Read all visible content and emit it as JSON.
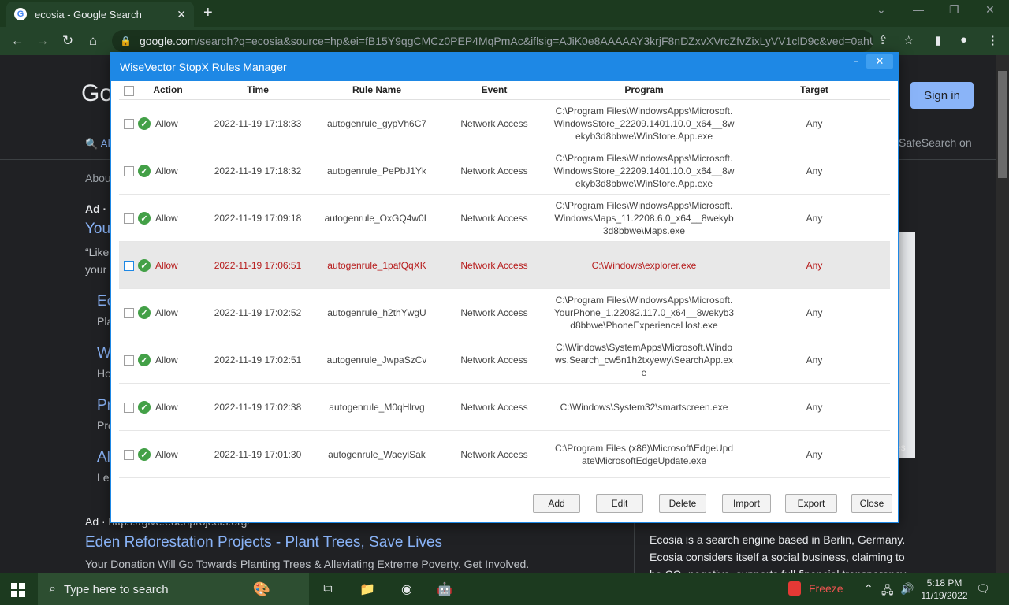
{
  "browser": {
    "tab_title": "ecosia - Google Search",
    "url_host": "google.com",
    "url_rest": "/search?q=ecosia&source=hp&ei=fB15Y9qgCMCz0PEP4MqPmAc&iflsig=AJiK0e8AAAAAY3krjF8nDZxvXVrcZfvZixLyVV1clD9c&ved=0ahU...",
    "icons": [
      "back-icon",
      "forward-icon",
      "reload-icon",
      "home-icon",
      "lock-icon",
      "share-icon",
      "star-icon",
      "sidebar-icon",
      "profile-icon",
      "menu-icon"
    ]
  },
  "page": {
    "logo_partial": "Go",
    "sign_in": "Sign in",
    "safesearch": "SafeSearch on",
    "all_tab_partial": "Al",
    "about_partial": "Abou",
    "ad_label_1": "Ad ·",
    "you_partial": "You",
    "like_partial": "“Like",
    "your_partial": "your s",
    "side_links": [
      "Ec",
      "W",
      "Pr",
      "Al"
    ],
    "side_texts": [
      "Pla",
      "Ho",
      "Pro",
      "Le"
    ],
    "ad_label_2": "Ad · https://give.edenprojects.org/",
    "ad_title": "Eden Reforestation Projects - Plant Trees, Save Lives",
    "ad_desc": "Your Donation Will Go Towards Planting Trees & Alleviating Extreme Poverty. Get Involved.",
    "right_text": "Ecosia is a search engine based in Berlin, Germany. Ecosia considers itself a social business, claiming to be CO- negative, supports full financial transparency",
    "img_caption_partial": "es"
  },
  "dialog": {
    "title": "WiseVector StopX Rules Manager",
    "columns": {
      "action": "Action",
      "time": "Time",
      "rule": "Rule Name",
      "event": "Event",
      "program": "Program",
      "target": "Target"
    },
    "rows": [
      {
        "action": "Allow",
        "time": "2022-11-19 17:18:33",
        "rule": "autogenrule_gypVh6C7",
        "event": "Network Access",
        "program": "C:\\Program Files\\WindowsApps\\Microsoft.WindowsStore_22209.1401.10.0_x64__8wekyb3d8bbwe\\WinStore.App.exe",
        "target": "Any"
      },
      {
        "action": "Allow",
        "time": "2022-11-19 17:18:32",
        "rule": "autogenrule_PePbJ1Yk",
        "event": "Network Access",
        "program": "C:\\Program Files\\WindowsApps\\Microsoft.WindowsStore_22209.1401.10.0_x64__8wekyb3d8bbwe\\WinStore.App.exe",
        "target": "Any"
      },
      {
        "action": "Allow",
        "time": "2022-11-19 17:09:18",
        "rule": "autogenrule_OxGQ4w0L",
        "event": "Network Access",
        "program": "C:\\Program Files\\WindowsApps\\Microsoft.WindowsMaps_11.2208.6.0_x64__8wekyb3d8bbwe\\Maps.exe",
        "target": "Any"
      },
      {
        "action": "Allow",
        "time": "2022-11-19 17:06:51",
        "rule": "autogenrule_1pafQqXK",
        "event": "Network Access",
        "program": "C:\\Windows\\explorer.exe",
        "target": "Any"
      },
      {
        "action": "Allow",
        "time": "2022-11-19 17:02:52",
        "rule": "autogenrule_h2thYwgU",
        "event": "Network Access",
        "program": "C:\\Program Files\\WindowsApps\\Microsoft.YourPhone_1.22082.117.0_x64__8wekyb3d8bbwe\\PhoneExperienceHost.exe",
        "target": "Any"
      },
      {
        "action": "Allow",
        "time": "2022-11-19 17:02:51",
        "rule": "autogenrule_JwpaSzCv",
        "event": "Network Access",
        "program": "C:\\Windows\\SystemApps\\Microsoft.Windows.Search_cw5n1h2txyewy\\SearchApp.exe",
        "target": "Any"
      },
      {
        "action": "Allow",
        "time": "2022-11-19 17:02:38",
        "rule": "autogenrule_M0qHlrvg",
        "event": "Network Access",
        "program": "C:\\Windows\\System32\\smartscreen.exe",
        "target": "Any"
      },
      {
        "action": "Allow",
        "time": "2022-11-19 17:01:30",
        "rule": "autogenrule_WaeyiSak",
        "event": "Network Access",
        "program": "C:\\Program Files (x86)\\Microsoft\\EdgeUpdate\\MicrosoftEdgeUpdate.exe",
        "target": "Any"
      }
    ],
    "buttons": {
      "add": "Add",
      "edit": "Edit",
      "delete": "Delete",
      "import": "Import",
      "export": "Export",
      "close": "Close"
    }
  },
  "taskbar": {
    "search_placeholder": "Type here to search",
    "freeze": "Freeze",
    "time": "5:18 PM",
    "date": "11/19/2022"
  },
  "colors": {
    "accent": "#1e88e5",
    "allow_icon": "#43a047",
    "selected_text": "#b71c1c"
  }
}
